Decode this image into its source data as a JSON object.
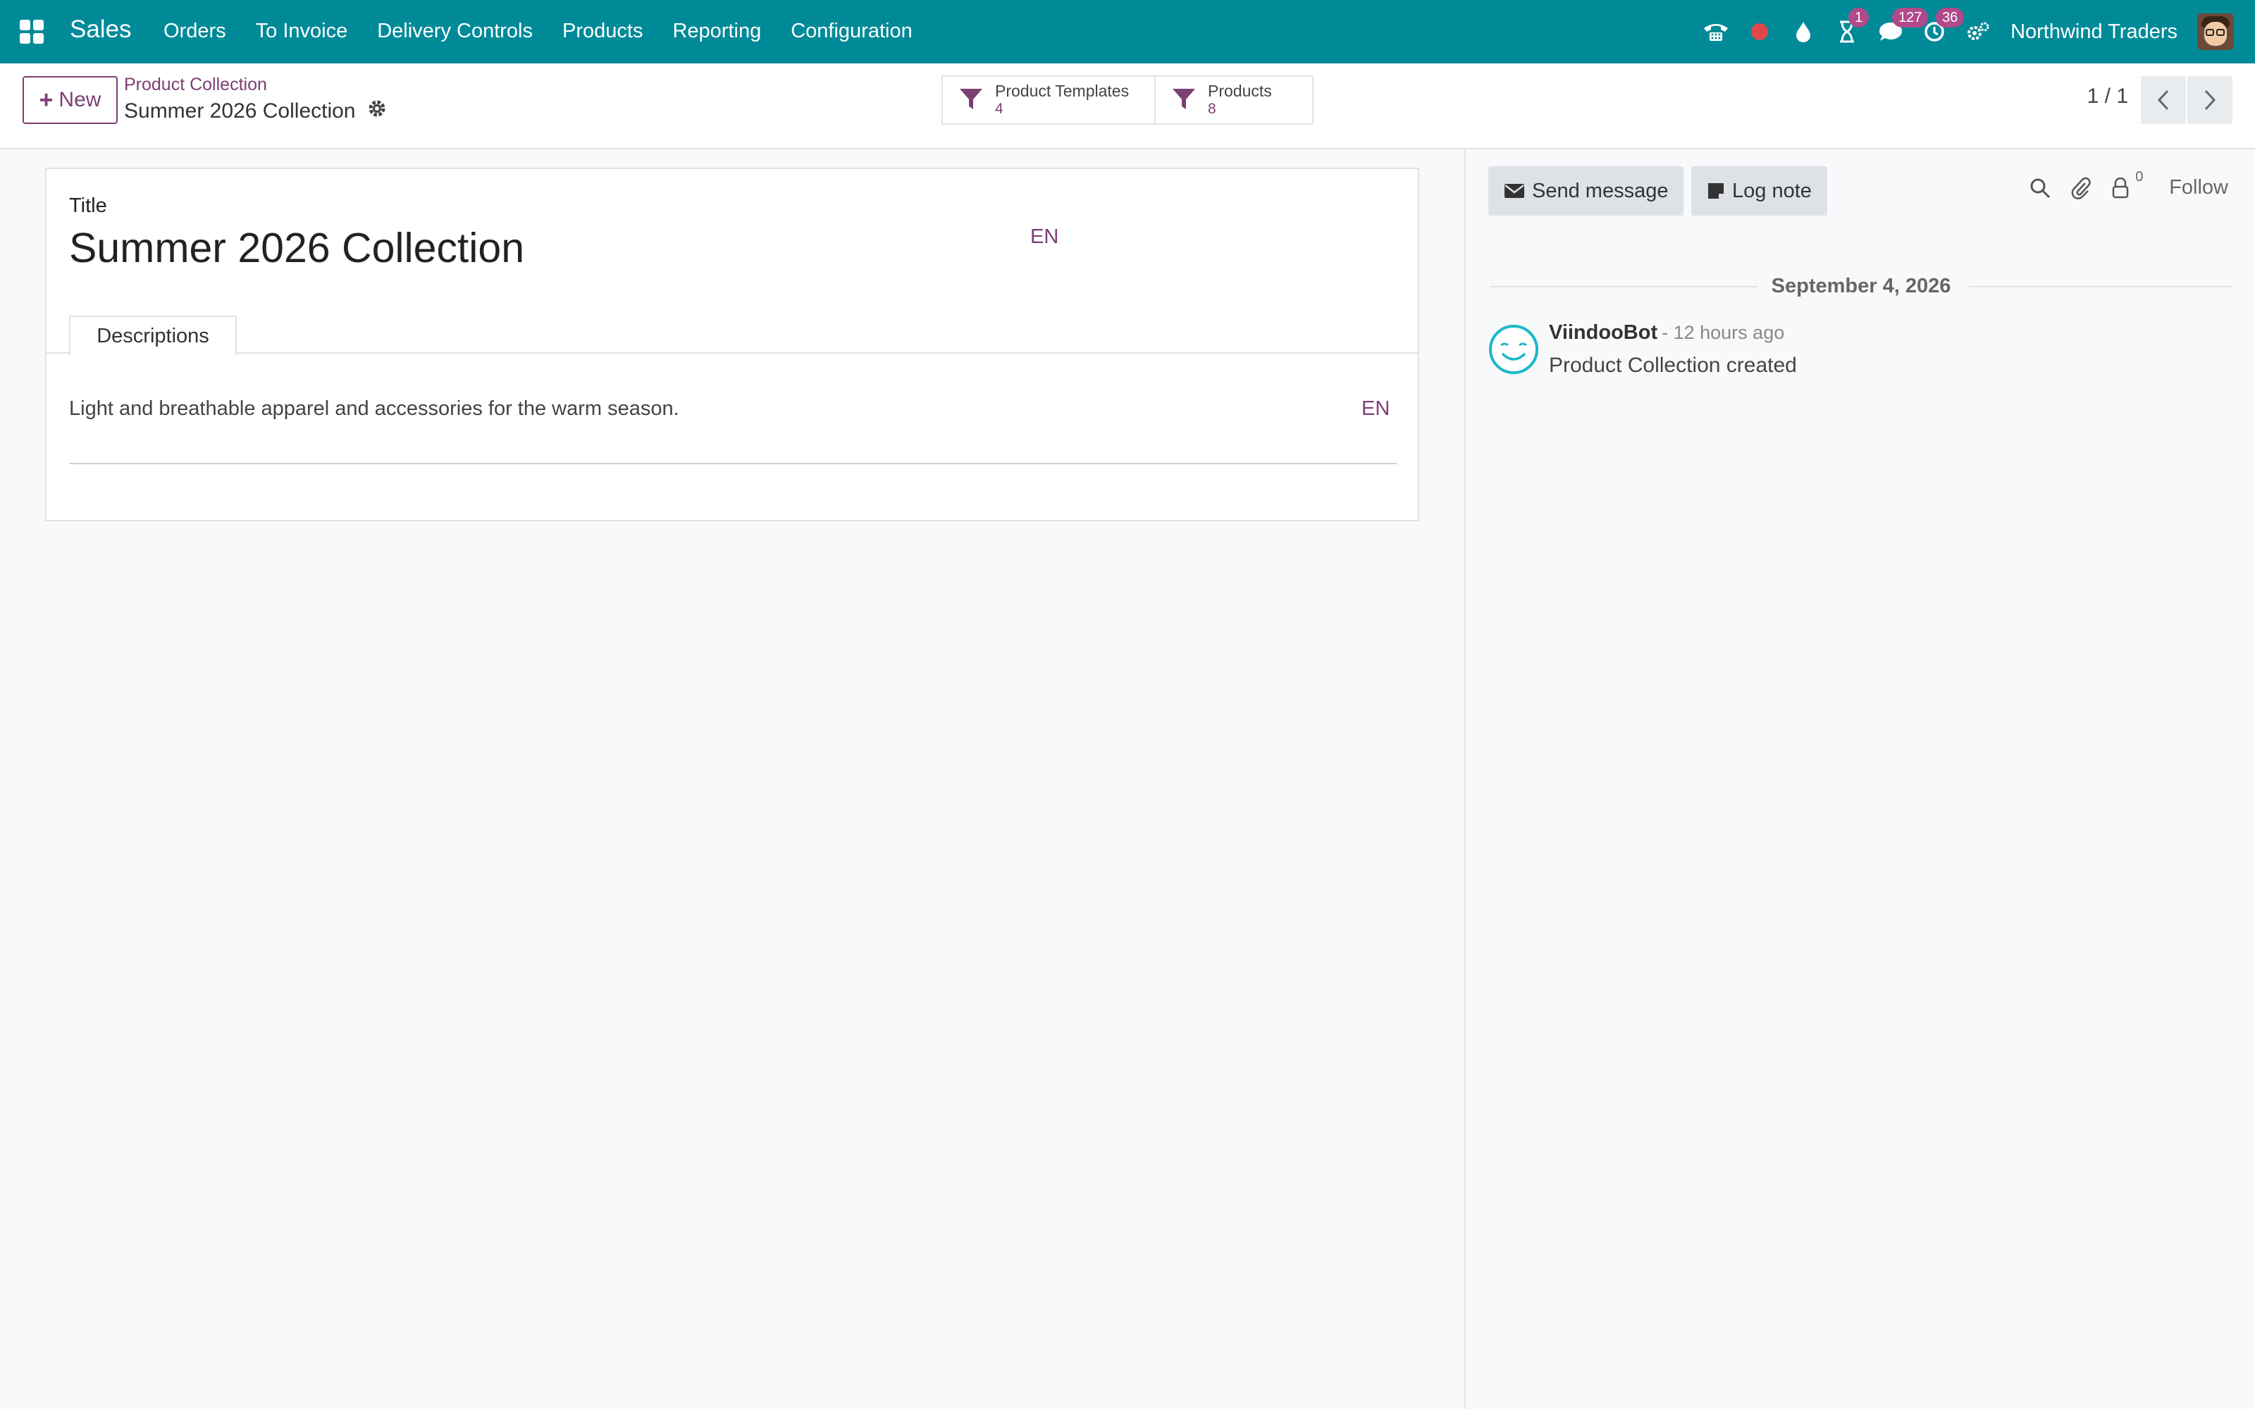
{
  "navbar": {
    "brand": "Sales",
    "menu": [
      "Orders",
      "To Invoice",
      "Delivery Controls",
      "Products",
      "Reporting",
      "Configuration"
    ],
    "badges": {
      "activities": "1",
      "messages": "127",
      "timer": "36"
    },
    "company": "Northwind Traders",
    "colors": {
      "bg": "#008a98",
      "accent": "#7c3f74"
    }
  },
  "control": {
    "new_label": "New",
    "breadcrumb": "Product Collection",
    "record_name": "Summer 2026 Collection",
    "smart_buttons": [
      {
        "label": "Product Templates",
        "value": "4"
      },
      {
        "label": "Products",
        "value": "8"
      }
    ],
    "pager": "1 / 1"
  },
  "form": {
    "title_label": "Title",
    "title_value": "Summer 2026 Collection",
    "lang": "EN",
    "tab_label": "Descriptions",
    "description": "Light and breathable apparel and accessories for the warm season.",
    "description_lang": "EN"
  },
  "chatter": {
    "send_message": "Send message",
    "log_note": "Log note",
    "followers": "0",
    "follow": "Follow",
    "date": "September 4, 2026",
    "message": {
      "author": "ViindooBot",
      "date": "- 12 hours ago",
      "body": "Product Collection created"
    }
  }
}
